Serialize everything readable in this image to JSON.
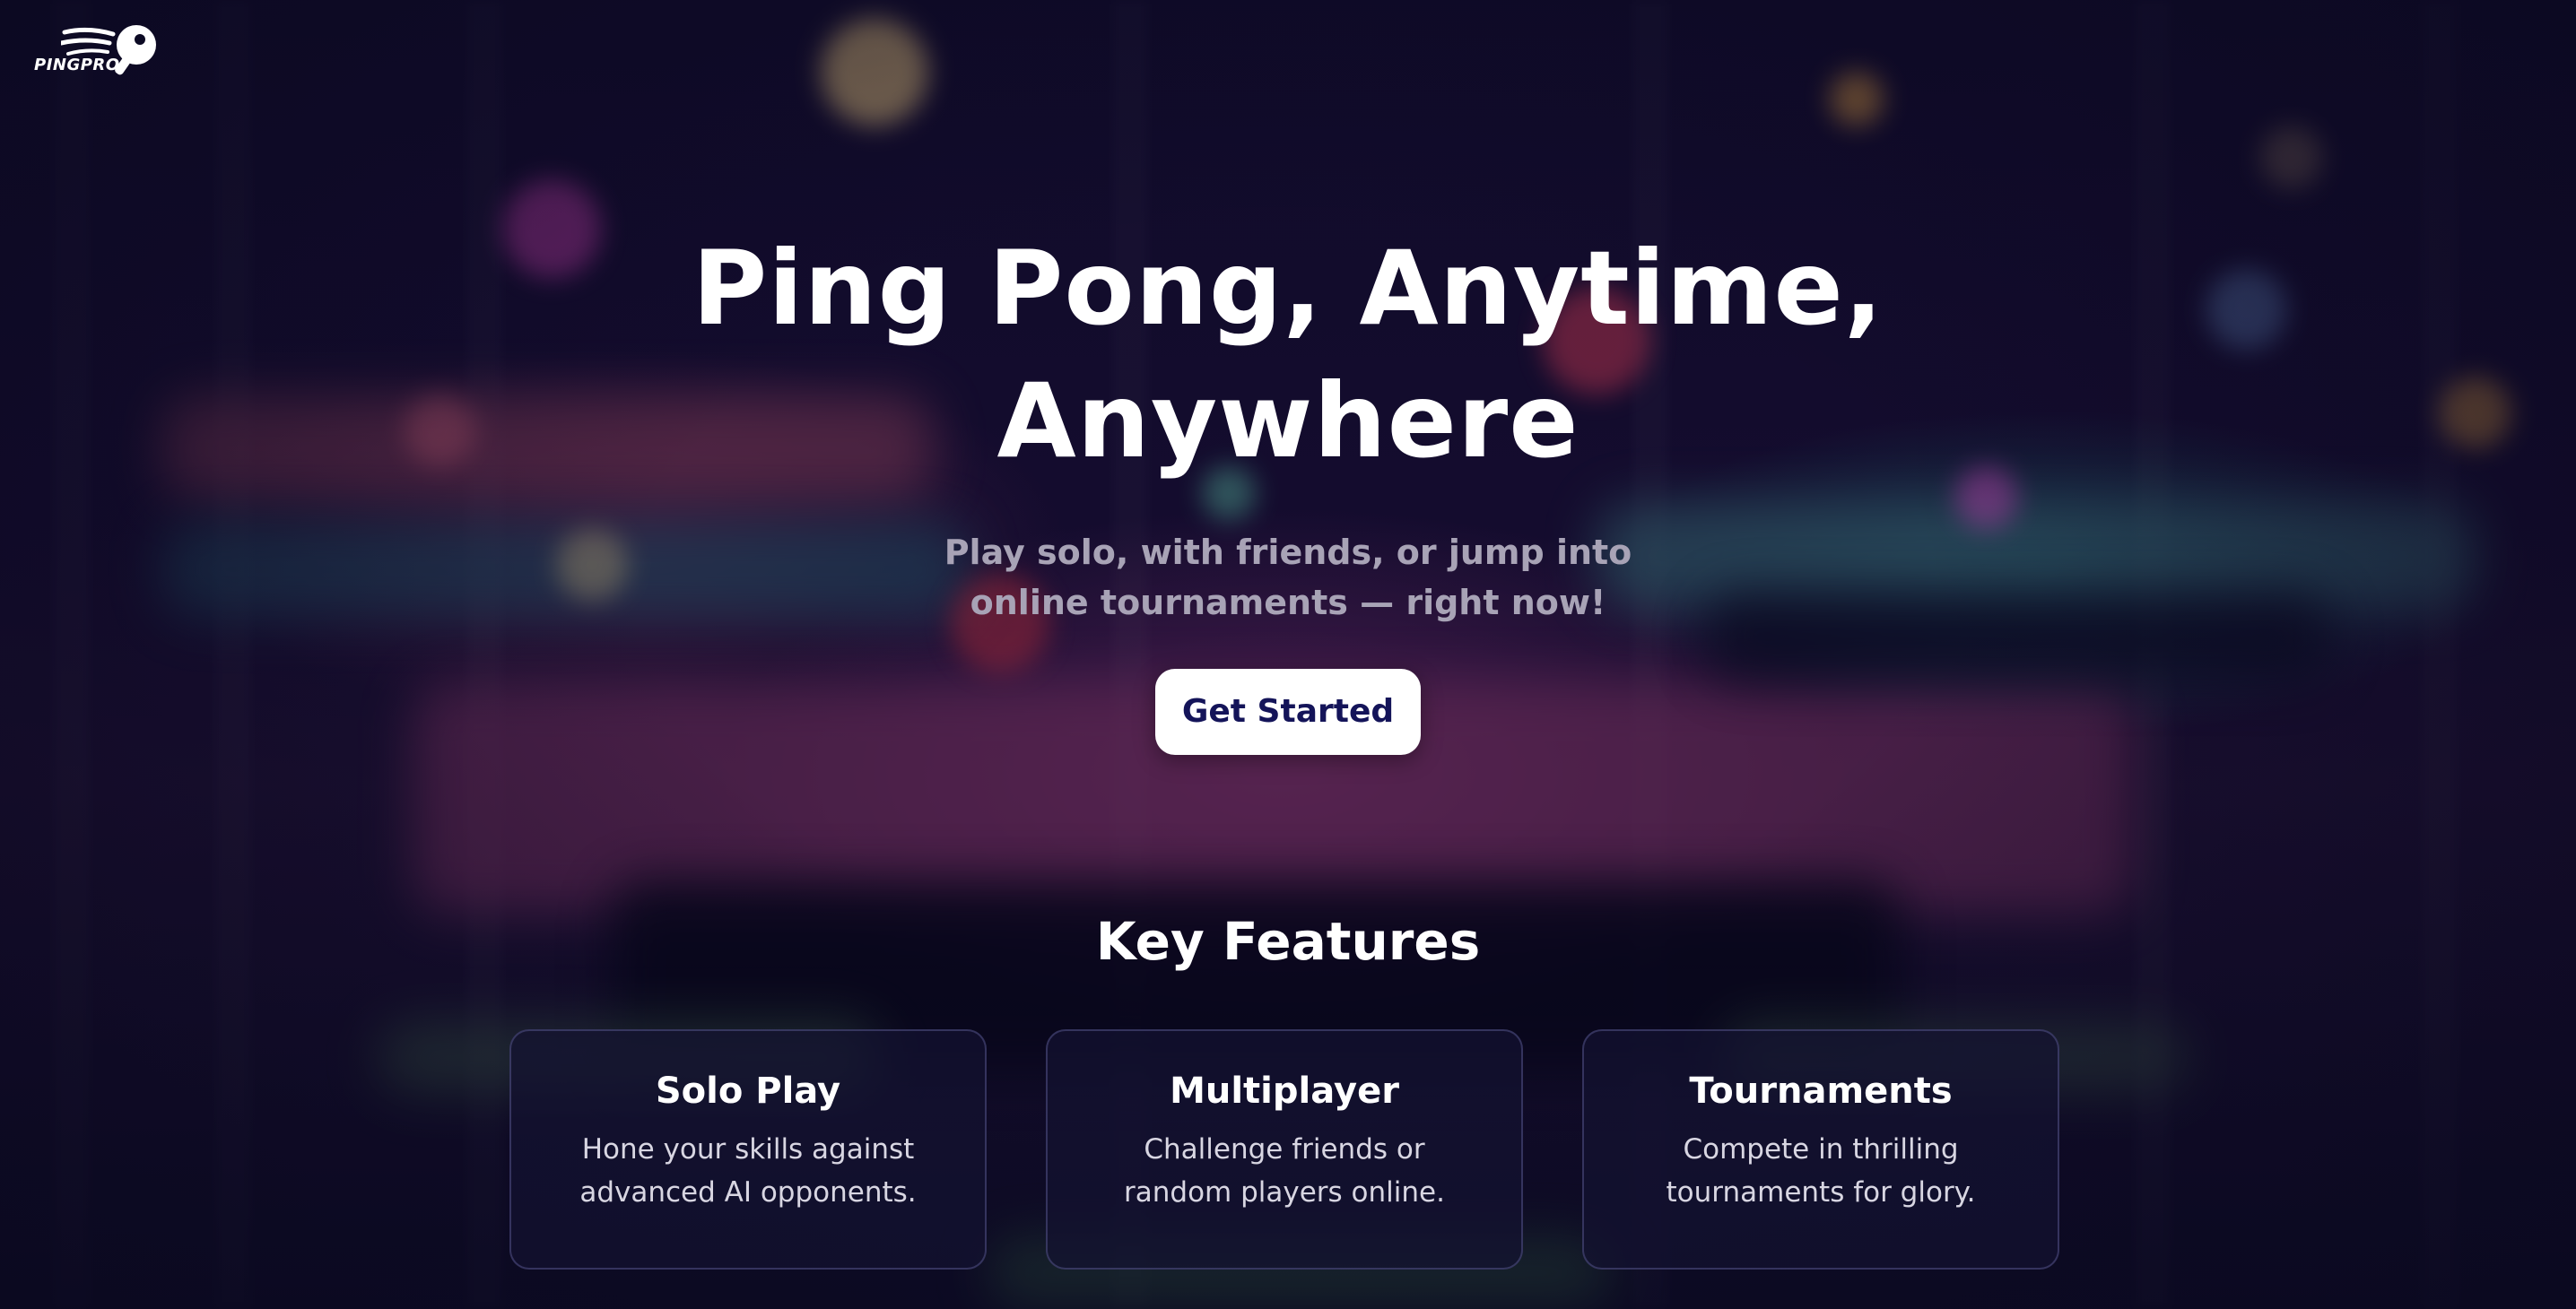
{
  "logo": {
    "text": "PINGPRO",
    "icon": "ping-pong-paddle-icon"
  },
  "hero": {
    "title": "Ping Pong, Anytime, Anywhere",
    "subtitle": "Play solo, with friends, or jump into online tournaments — right now!",
    "cta_label": "Get Started"
  },
  "features": {
    "title": "Key Features",
    "items": [
      {
        "title": "Solo Play",
        "description": "Hone your skills against advanced AI opponents."
      },
      {
        "title": "Multiplayer",
        "description": "Challenge friends or random players online."
      },
      {
        "title": "Tournaments",
        "description": "Compete in thrilling tournaments for glory."
      }
    ]
  },
  "colors": {
    "background": "#0c0a24",
    "cta_background": "#ffffff",
    "cta_text": "#141459",
    "subtitle_text": "#a8a3b6"
  }
}
